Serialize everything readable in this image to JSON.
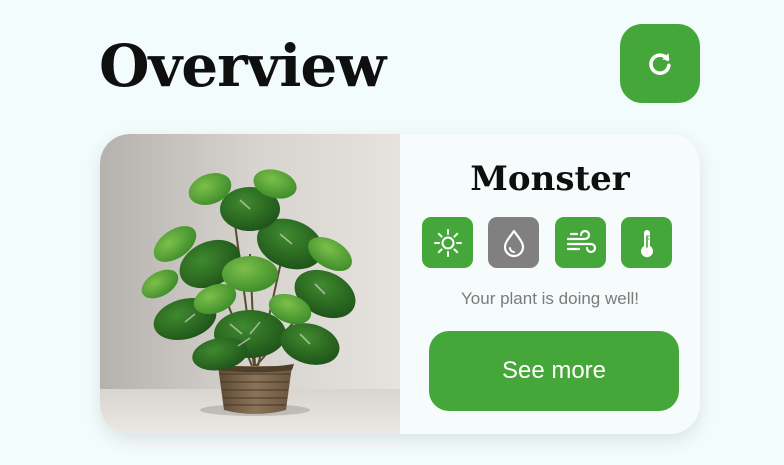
{
  "header": {
    "title": "Overview",
    "refresh_icon": "refresh-icon"
  },
  "colors": {
    "background": "#f3fcfc",
    "accent": "#45a63a",
    "inactive": "#808080",
    "title_text": "#0f0f0f",
    "status_text": "#7b7b7b"
  },
  "plant_card": {
    "name": "Monster",
    "photo": "monstera-plant-in-wicker-basket",
    "indicators": [
      {
        "icon": "sun-icon",
        "status": "ok",
        "color": "#45a63a"
      },
      {
        "icon": "water-drop-icon",
        "status": "inactive",
        "color": "#808080"
      },
      {
        "icon": "wind-icon",
        "status": "ok",
        "color": "#45a63a"
      },
      {
        "icon": "thermometer-icon",
        "status": "ok",
        "color": "#45a63a"
      }
    ],
    "status_message": "Your plant is doing well!",
    "see_more_label": "See more"
  }
}
